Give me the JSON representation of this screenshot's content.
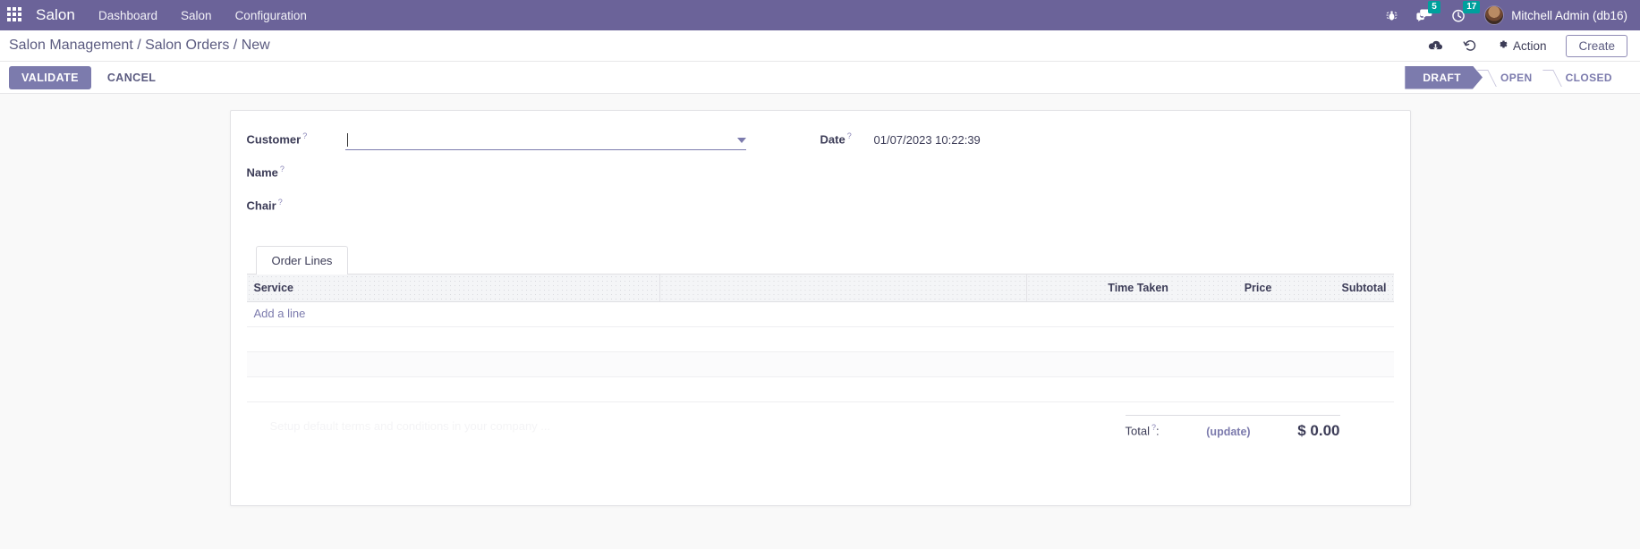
{
  "navbar": {
    "apps_icon": "apps-grid-icon",
    "brand": "Salon",
    "menu": [
      {
        "label": "Dashboard"
      },
      {
        "label": "Salon"
      },
      {
        "label": "Configuration"
      }
    ],
    "bug_icon": "bug-icon",
    "messages": {
      "icon": "chat-bubble-icon",
      "count": "5"
    },
    "activities": {
      "icon": "clock-icon",
      "count": "17"
    },
    "user": "Mitchell Admin (db16)",
    "badge_color": "#00a09d",
    "background_color": "#6b6399"
  },
  "control_panel": {
    "breadcrumb": "Salon Management / Salon Orders / New",
    "save_icon": "cloud-upload-icon",
    "discard_icon": "undo-icon",
    "action_label": "Action",
    "action_icon": "gear-icon",
    "create_label": "Create"
  },
  "statusbar": {
    "validate_label": "VALIDATE",
    "cancel_label": "CANCEL",
    "stages": [
      {
        "label": "DRAFT",
        "active": true
      },
      {
        "label": "OPEN",
        "active": false
      },
      {
        "label": "CLOSED",
        "active": false
      }
    ],
    "active_color": "#7c7bad"
  },
  "form": {
    "help_mark": "?",
    "left": [
      {
        "label": "Customer",
        "value": "",
        "placeholder": "",
        "type": "many2one"
      },
      {
        "label": "Name",
        "value": "",
        "type": "text"
      },
      {
        "label": "Chair",
        "value": "",
        "type": "text"
      }
    ],
    "right": [
      {
        "label": "Date",
        "value": "01/07/2023 10:22:39",
        "type": "datetime"
      }
    ]
  },
  "notebook": {
    "tabs": [
      {
        "label": "Order Lines",
        "active": true
      }
    ],
    "table": {
      "columns": [
        "Service",
        "Time Taken",
        "Price",
        "Subtotal"
      ],
      "rows": [],
      "add_line_label": "Add a line"
    }
  },
  "footer": {
    "terms_placeholder": "Setup default terms and conditions in your company ...",
    "total_label": "Total",
    "total_separator": ":",
    "update_label": "(update)",
    "total_amount": "$ 0.00"
  }
}
